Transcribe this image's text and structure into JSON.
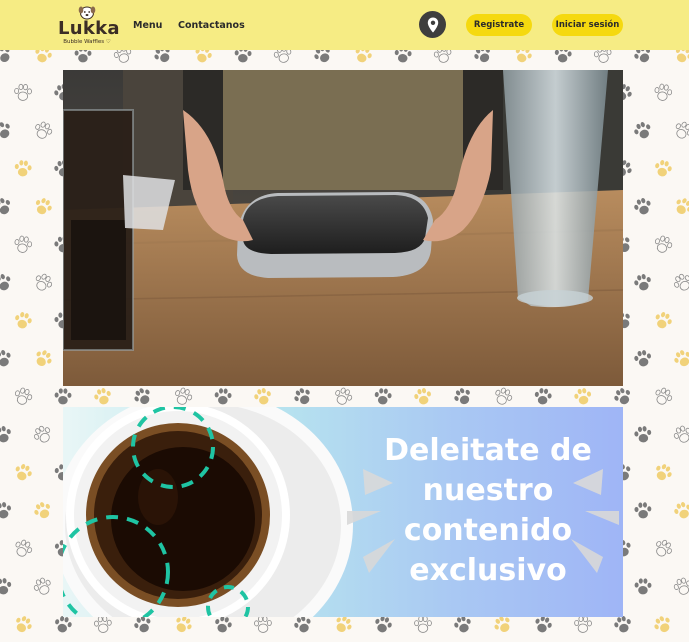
{
  "brand": {
    "name": "Lukka",
    "tagline": "Bubble Waffles ♡"
  },
  "nav": {
    "menu_label": "Menu",
    "contact_label": "Contactanos"
  },
  "actions": {
    "location_icon": "map-pin-icon",
    "register_label": "Registrate",
    "login_label": "Iniciar sesión"
  },
  "banner": {
    "lines": [
      "Deleitate de",
      "nuestro",
      "contenido",
      "exclusivo"
    ]
  },
  "colors": {
    "header_bg": "#f6ec84",
    "button_bg": "#f5d90f",
    "page_bg": "#fbf8f4",
    "paw_gray": "#7a7a7a",
    "paw_yellow": "#f1d27a",
    "accent_teal": "#1fc4a3"
  }
}
